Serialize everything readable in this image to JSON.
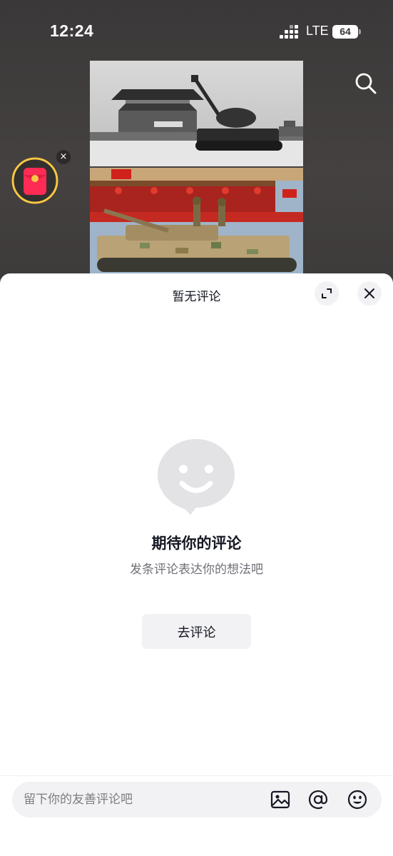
{
  "status_bar": {
    "time": "12:24",
    "network": "LTE",
    "battery": "64"
  },
  "video": {
    "search_icon": "search-icon",
    "red_packet_icon": "red-envelope-icon",
    "red_packet_close": "×"
  },
  "comments_sheet": {
    "title": "暂无评论",
    "expand_icon": "expand-icon",
    "close_icon": "close-icon",
    "empty_state": {
      "icon": "smiley-speech-bubble-icon",
      "title": "期待你的评论",
      "subtitle": "发条评论表达你的想法吧",
      "button_label": "去评论"
    },
    "input": {
      "placeholder": "留下你的友善评论吧",
      "value": "",
      "icons": [
        "image-icon",
        "at-mention-icon",
        "emoji-icon"
      ]
    }
  },
  "colors": {
    "background_dark": "#3b3838",
    "sheet_background": "#ffffff",
    "button_background": "#f2f2f4",
    "primary_text": "#161823",
    "secondary_text": "#6f7077",
    "red_packet": "#fe2c55",
    "red_packet_ring": "#f7c744"
  }
}
